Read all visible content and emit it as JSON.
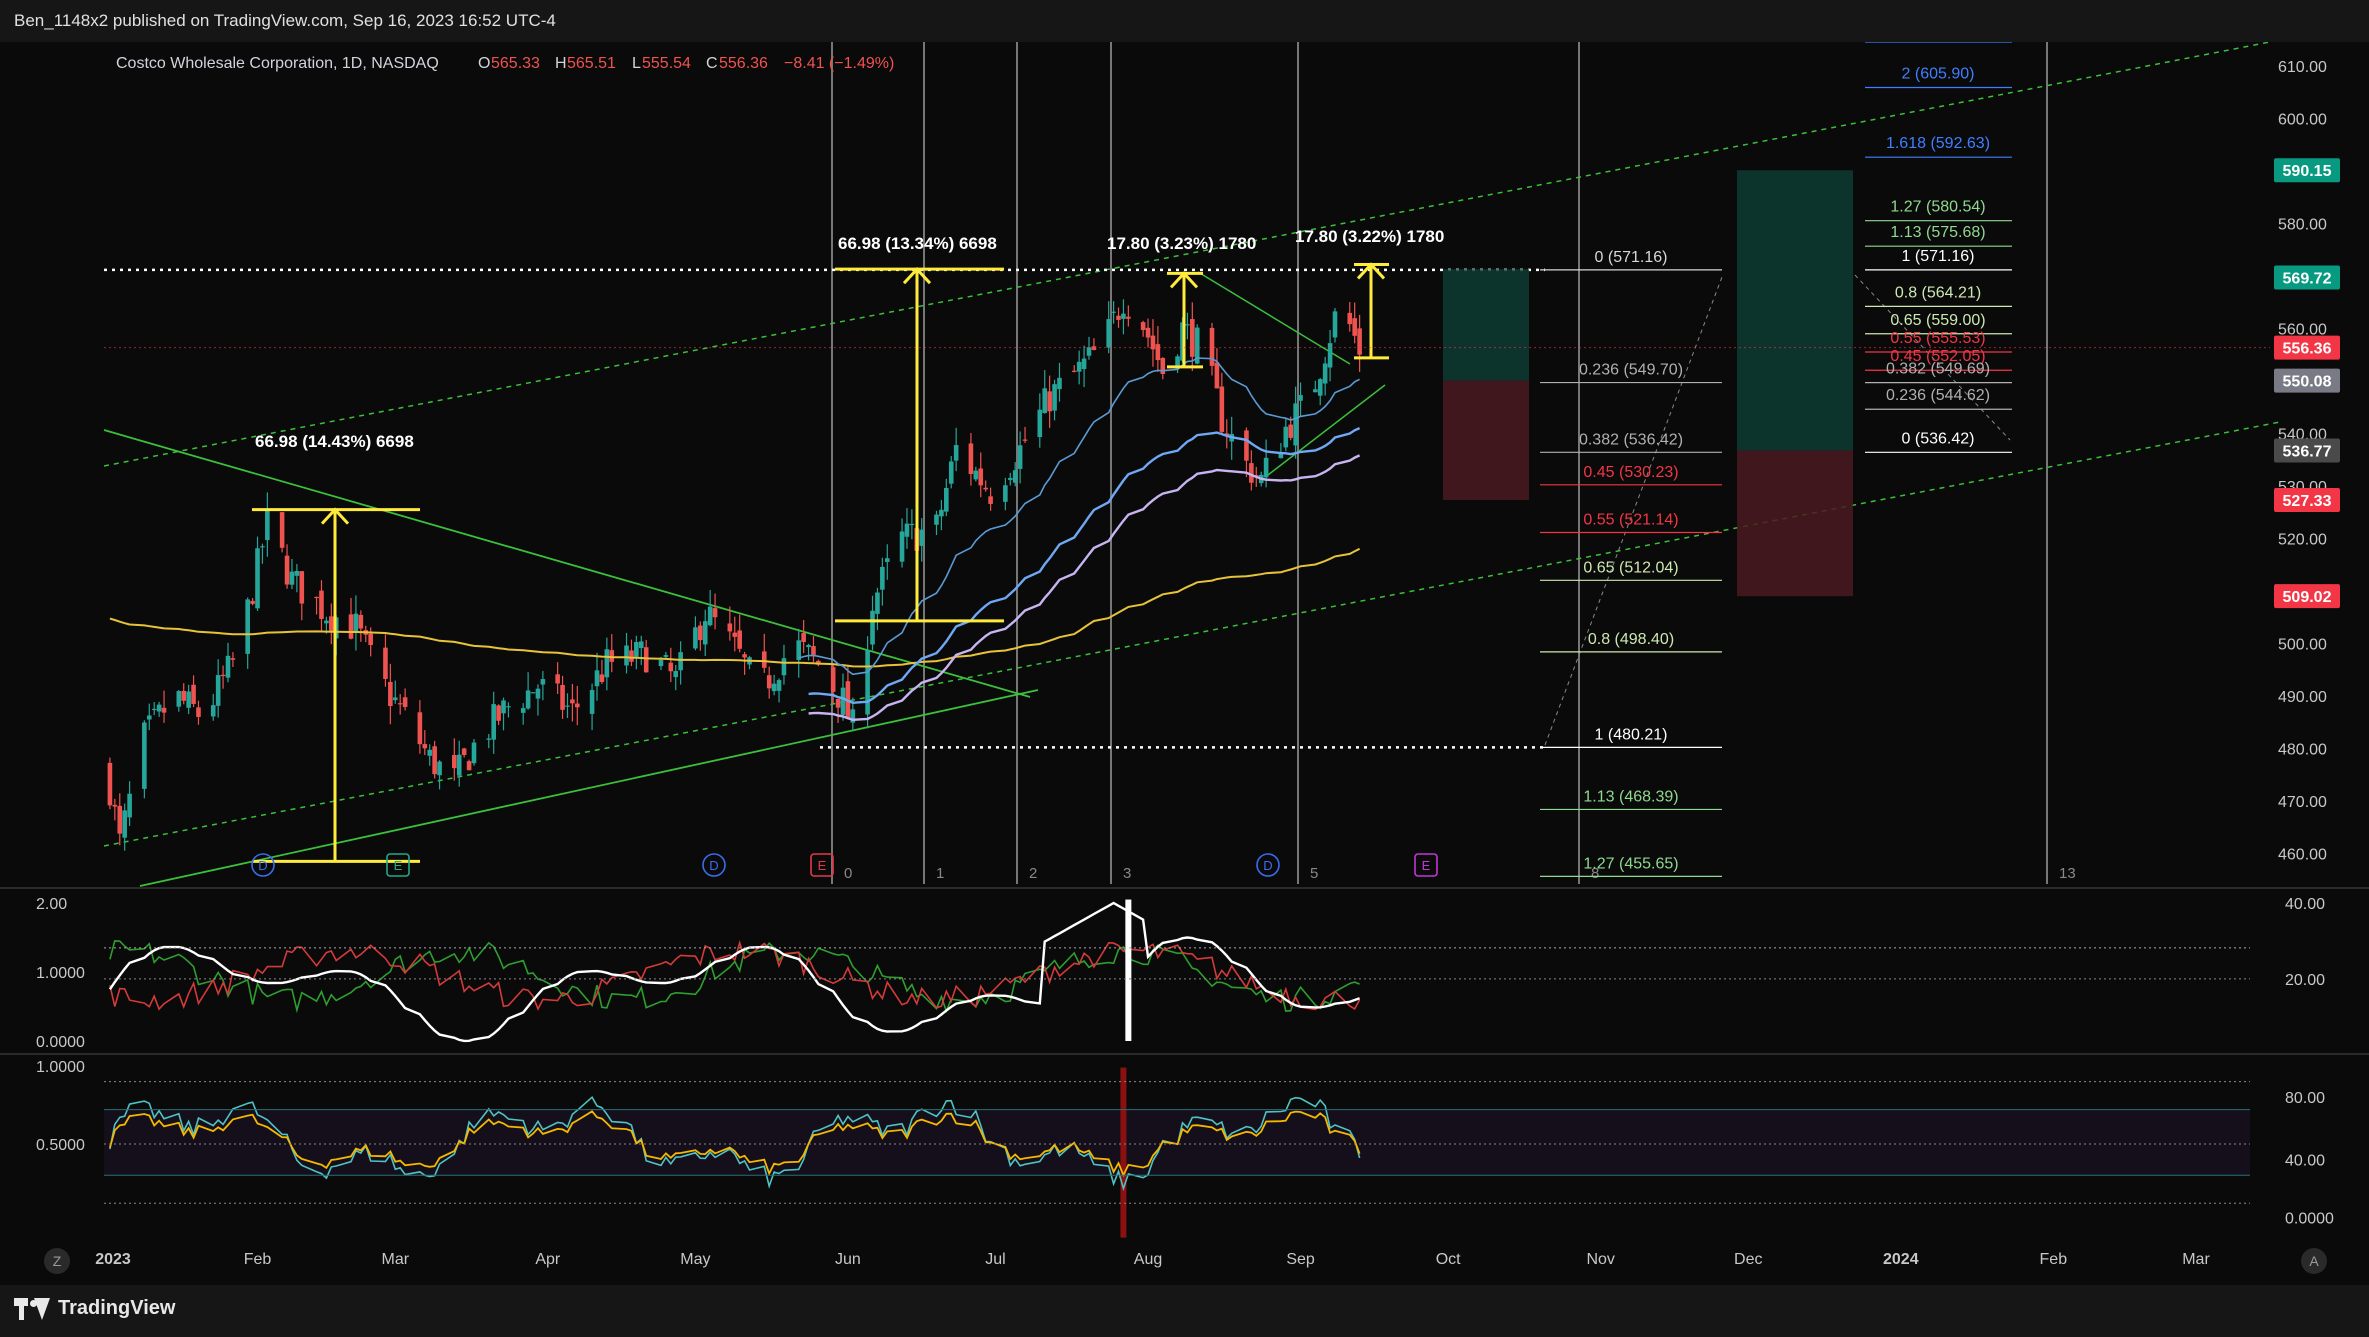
{
  "header": {
    "published_by": "Ben_1148x2 published on TradingView.com, Sep 16, 2023 16:52 UTC-4"
  },
  "footer": {
    "brand": "TradingView"
  },
  "corner_buttons": {
    "left": "Z",
    "right": "A"
  },
  "colors": {
    "background": "#0a0a0a",
    "up_candle": "#26a69a",
    "down_candle": "#ef5350",
    "annotation_yellow": "#ffeb3b",
    "ema_fast": "#5b9bd5",
    "ema_mid": "#6fa8f5",
    "ema_slow": "#c8b4f0",
    "sma_200": "#e8c33a",
    "trend_green": "#3cbf3c"
  },
  "chart_data": [
    {
      "type": "candlestick",
      "title": "Costco Wholesale Corporation, 1D, NASDAQ",
      "ohlc": {
        "open_label": "O",
        "open": "565.33",
        "high_label": "H",
        "high": "565.51",
        "low_label": "L",
        "low": "555.54",
        "close_label": "C",
        "close": "556.36",
        "change": "−8.41 (−1.49%)"
      },
      "x_ticks": [
        "2023",
        "Feb",
        "Mar",
        "Apr",
        "May",
        "Jun",
        "Jul",
        "Aug",
        "Sep",
        "Oct",
        "Nov",
        "Dec",
        "2024",
        "Feb",
        "Mar"
      ],
      "y_ticks": [
        "610.00",
        "600.00",
        "590.00",
        "580.00",
        "570.00",
        "560.00",
        "550.00",
        "540.00",
        "530.00",
        "520.00",
        "510.00",
        "500.00",
        "490.00",
        "480.00",
        "470.00",
        "460.00"
      ],
      "ylim": [
        455,
        614
      ],
      "price_tags": [
        {
          "label": "590.15",
          "value": 590.15,
          "color": "#089981"
        },
        {
          "label": "569.72",
          "value": 569.72,
          "color": "#089981"
        },
        {
          "label": "556.36",
          "value": 556.36,
          "color": "#f23645"
        },
        {
          "label": "550.08",
          "value": 550.08,
          "color": "#787b86"
        },
        {
          "label": "536.77",
          "value": 536.77,
          "color": "#4a4a4a"
        },
        {
          "label": "527.33",
          "value": 527.33,
          "color": "#f23645"
        },
        {
          "label": "509.02",
          "value": 509.02,
          "color": "#f23645"
        }
      ],
      "measure_labels": [
        {
          "text": "66.98 (14.43%) 6698"
        },
        {
          "text": "66.98 (13.34%) 6698"
        },
        {
          "text": "17.80 (3.23%) 1780"
        },
        {
          "text": "17.80 (3.22%) 1780"
        }
      ],
      "fib_retracement": [
        {
          "label": "0 (571.16)",
          "value": 571.16,
          "color": "#d8d8d8"
        },
        {
          "label": "0.236 (549.70)",
          "value": 549.7,
          "color": "#b0b0b0"
        },
        {
          "label": "0.382 (536.42)",
          "value": 536.42,
          "color": "#b0b0b0"
        },
        {
          "label": "0.45 (530.23)",
          "value": 530.23,
          "color": "#f23645"
        },
        {
          "label": "0.55 (521.14)",
          "value": 521.14,
          "color": "#f23645"
        },
        {
          "label": "0.65 (512.04)",
          "value": 512.04,
          "color": "#cde8b0"
        },
        {
          "label": "0.8 (498.40)",
          "value": 498.4,
          "color": "#cde8b0"
        },
        {
          "label": "1 (480.21)",
          "value": 480.21,
          "color": "#ffffff"
        },
        {
          "label": "1.13 (468.39)",
          "value": 468.39,
          "color": "#8fd88f"
        },
        {
          "label": "1.27 (455.65)",
          "value": 455.65,
          "color": "#8fd88f"
        }
      ],
      "fib_extension": [
        {
          "label": "2 (605.90)",
          "value": 605.9,
          "color": "#3f7fff"
        },
        {
          "label": "1.618 (592.63)",
          "value": 592.63,
          "color": "#3f7fff"
        },
        {
          "label": "1.27 (580.54)",
          "value": 580.54,
          "color": "#8fd88f"
        },
        {
          "label": "1.13 (575.68)",
          "value": 575.68,
          "color": "#8fd88f"
        },
        {
          "label": "1 (571.16)",
          "value": 571.16,
          "color": "#ffffff"
        },
        {
          "label": "0.8 (564.21)",
          "value": 564.21,
          "color": "#cde8b0"
        },
        {
          "label": "0.65 (559.00)",
          "value": 559.0,
          "color": "#cde8b0"
        },
        {
          "label": "0.55 (555.53)",
          "value": 555.53,
          "color": "#f23645"
        },
        {
          "label": "0.45 (552.05)",
          "value": 552.05,
          "color": "#f23645"
        },
        {
          "label": "0.382 (549.69)",
          "value": 549.69,
          "color": "#b0b0b0"
        },
        {
          "label": "0.236 (544.62)",
          "value": 544.62,
          "color": "#b0b0b0"
        },
        {
          "label": "0 (536.42)",
          "value": 536.42,
          "color": "#ffffff"
        }
      ],
      "fib_time_labels": [
        "0",
        "1",
        "2",
        "3",
        "5",
        "8",
        "13"
      ],
      "event_markers": [
        {
          "label": "D",
          "kind": "dividend"
        },
        {
          "label": "E",
          "kind": "earnings"
        },
        {
          "label": "D",
          "kind": "dividend"
        },
        {
          "label": "E",
          "kind": "earnings"
        },
        {
          "label": "D",
          "kind": "dividend"
        },
        {
          "label": "E",
          "kind": "earnings"
        }
      ]
    },
    {
      "type": "line",
      "y_ticks_left": [
        "2.00",
        "1.0000",
        "0.0000"
      ],
      "y_ticks_right": [
        "40.00",
        "20.00"
      ],
      "series": [
        {
          "color": "#ffffff"
        },
        {
          "color": "#2e9e2e"
        },
        {
          "color": "#d43a3a"
        }
      ]
    },
    {
      "type": "line",
      "y_ticks_left": [
        "1.0000",
        "0.5000"
      ],
      "y_ticks_right": [
        "80.00",
        "40.00",
        "0.0000"
      ],
      "series": [
        {
          "color": "#4fc3c3"
        },
        {
          "color": "#f5b700"
        }
      ]
    }
  ]
}
